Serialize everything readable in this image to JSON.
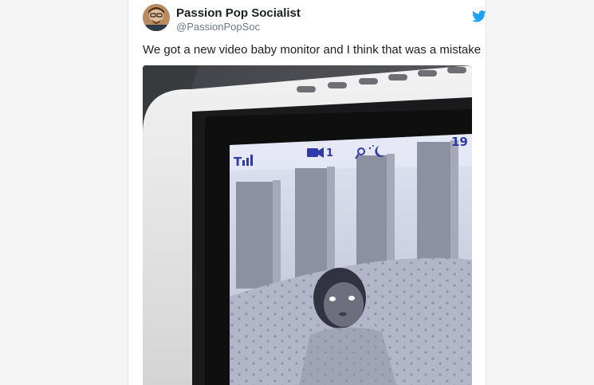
{
  "tweet": {
    "author_name": "Passion Pop Socialist",
    "author_handle": "@PassionPopSoc",
    "text": "We got a new video baby monitor and I think that was a mistake",
    "avatar_icon": "avatar-photo",
    "brand_icon": "twitter-bird-icon",
    "brand_color": "#1da1f2"
  },
  "media": {
    "monitor_screen": {
      "camera_number": "1",
      "clock_partial": "19"
    }
  }
}
